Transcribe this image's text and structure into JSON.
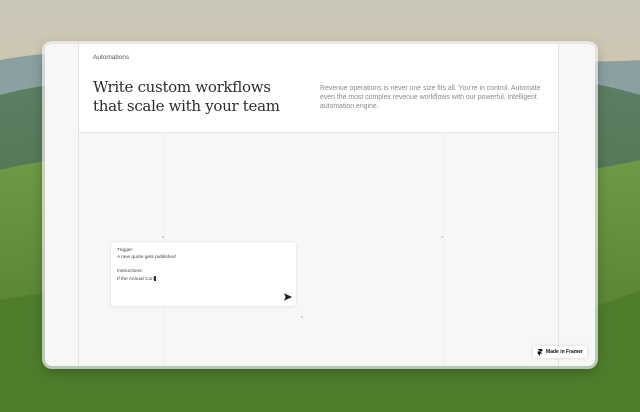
{
  "page": {
    "breadcrumb": "Automations",
    "headline_line1": "Write custom workflows",
    "headline_line2": "that scale with your team",
    "blurb": "Revenue operations is never one size fits all. You're in control. Automate even the most complex revenue workflows with our powerful, intelligent automation engine."
  },
  "prompt_card": {
    "trigger_label": "Trigger:",
    "trigger_value": "A new quote gets published",
    "instructions_label": "Instructions:",
    "instructions_value": "If the Annual Con"
  },
  "icons": {
    "send": "send-icon",
    "framer": "framer-logo-icon"
  },
  "badge": {
    "label": "Made in Framer"
  },
  "colors": {
    "headline": "#2d2d2d",
    "blurb": "#8a8a8a",
    "canvas": "#f7f7f7"
  }
}
